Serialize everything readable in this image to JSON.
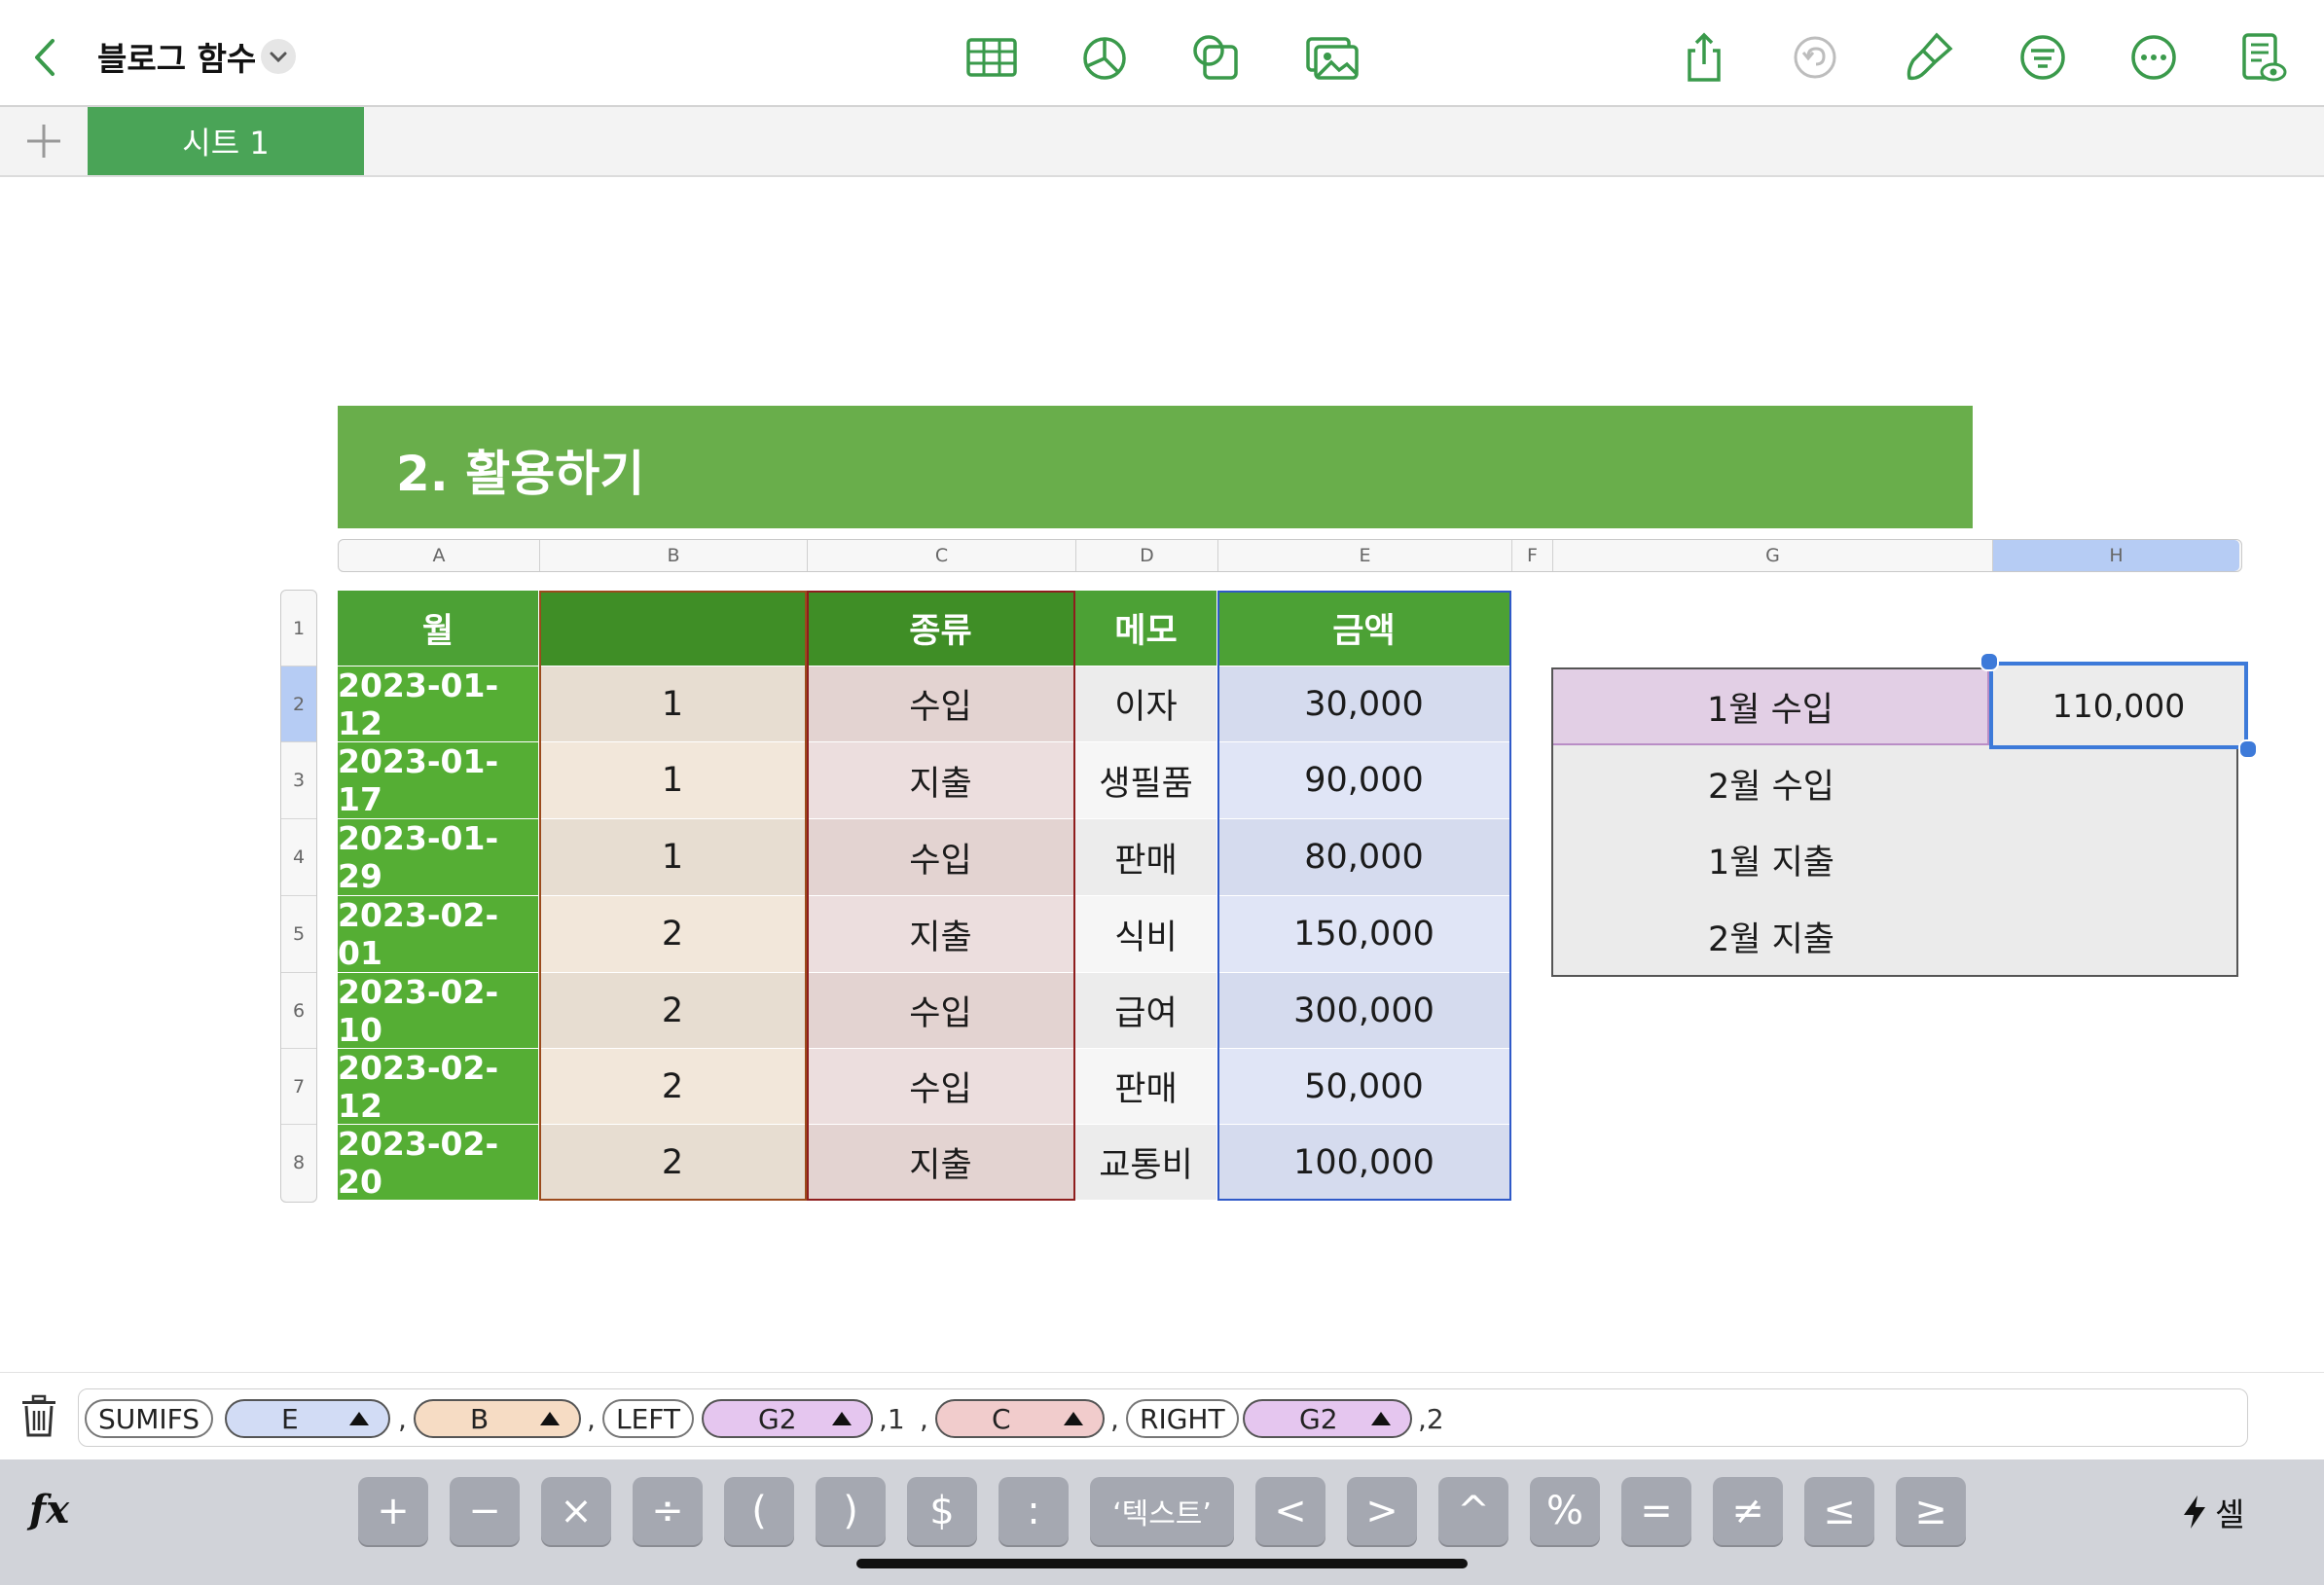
{
  "toolbar": {
    "doc_title": "블로그 함수",
    "icons": [
      "back-icon",
      "table-icon",
      "chart-icon",
      "shape-icon",
      "media-icon",
      "share-icon",
      "undo-icon",
      "format-brush-icon",
      "organize-icon",
      "more-icon",
      "document-view-icon"
    ]
  },
  "tabs": {
    "sheet": "시트 1"
  },
  "banner": {
    "title": "2. 활용하기"
  },
  "columns": [
    "A",
    "B",
    "C",
    "D",
    "E",
    "F",
    "G",
    "H"
  ],
  "rows": [
    "1",
    "2",
    "3",
    "4",
    "5",
    "6",
    "7",
    "8"
  ],
  "table": {
    "headers": [
      "월",
      "",
      "종류",
      "메모",
      "금액"
    ],
    "data": [
      [
        "2023-01-12",
        "1",
        "수입",
        "이자",
        "30,000"
      ],
      [
        "2023-01-17",
        "1",
        "지출",
        "생필품",
        "90,000"
      ],
      [
        "2023-01-29",
        "1",
        "수입",
        "판매",
        "80,000"
      ],
      [
        "2023-02-01",
        "2",
        "지출",
        "식비",
        "150,000"
      ],
      [
        "2023-02-10",
        "2",
        "수입",
        "급여",
        "300,000"
      ],
      [
        "2023-02-12",
        "2",
        "수입",
        "판매",
        "50,000"
      ],
      [
        "2023-02-20",
        "2",
        "지출",
        "교통비",
        "100,000"
      ]
    ]
  },
  "side_table": {
    "labels": [
      "1월 수입",
      "2월 수입",
      "1월 지출",
      "2월 지출"
    ],
    "active_value": "110,000"
  },
  "formula": {
    "sumifs": "SUMIFS",
    "ref_e": "E",
    "ref_b": "B",
    "left": "LEFT",
    "ref_g2a": "G2",
    "arg1": ",1",
    "ref_c": "C",
    "right": "RIGHT",
    "ref_g2b": "G2",
    "arg2": ",2",
    "comma": ",",
    "colors": {
      "E": "#d2dcf5",
      "B": "#f6dcc4",
      "G2": "#e5c6ef",
      "C": "#f1cccc"
    }
  },
  "keyboard": {
    "keys": [
      "+",
      "−",
      "×",
      "÷",
      "(",
      ")",
      "$",
      ":",
      "‘텍스트’",
      "<",
      ">",
      "^",
      "%",
      "=",
      "≠",
      "≤",
      "≥"
    ],
    "fx": "fx",
    "cell_label": "셀"
  },
  "accent": "#4aa457"
}
